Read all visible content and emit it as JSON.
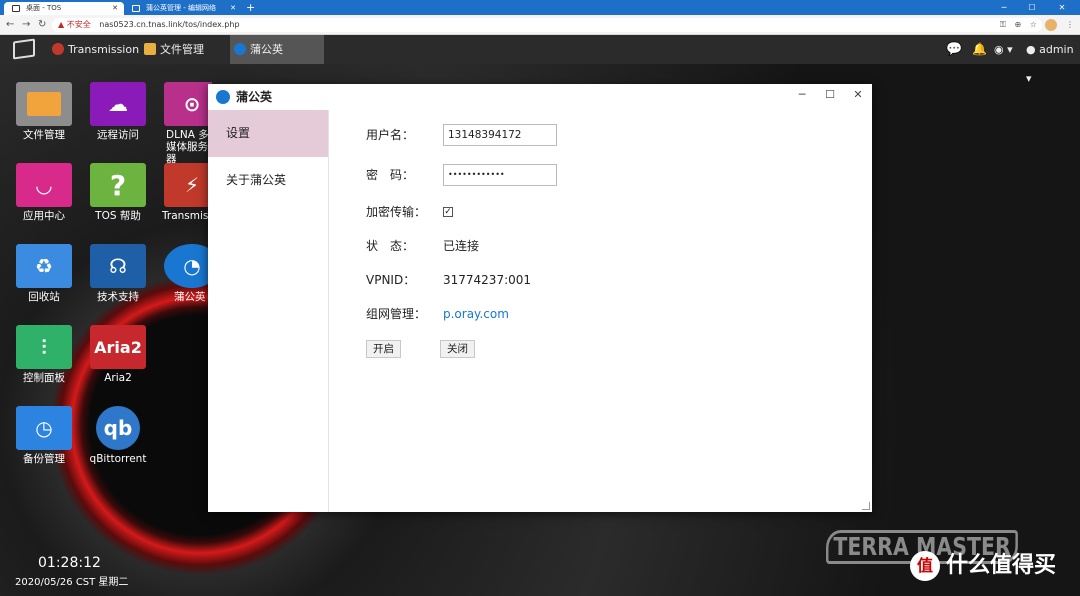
{
  "browser": {
    "tabs": [
      {
        "label": "桌面 - TOS",
        "active": true
      },
      {
        "label": "蒲公英管理 - 编辑网络",
        "active": false
      }
    ],
    "insecure_label": "不安全",
    "url": "nas0523.cn.tnas.link/tos/index.php"
  },
  "taskbar": {
    "items": [
      {
        "label": "Transmission"
      },
      {
        "label": "文件管理"
      },
      {
        "label": "蒲公英"
      }
    ],
    "user": "admin"
  },
  "desktop_icons": [
    {
      "label": "文件管理",
      "color": "#8d8d8d",
      "icon": "folder-icon"
    },
    {
      "label": "远程访问",
      "color": "#8b1bb8",
      "icon": "cloud-icon"
    },
    {
      "label": "DLNA 多媒体服务器",
      "color": "#b8308a",
      "icon": "dlna-icon"
    },
    {
      "label": "应用中心",
      "color": "#d82a8b",
      "icon": "shopping-bag-icon"
    },
    {
      "label": "TOS 帮助",
      "color": "#6db33f",
      "icon": "question-icon"
    },
    {
      "label": "Transmission",
      "color": "#c0392b",
      "icon": "transmission-icon"
    },
    {
      "label": "回收站",
      "color": "#3b8be0",
      "icon": "recycle-icon"
    },
    {
      "label": "技术支持",
      "color": "#1e5fa8",
      "icon": "headset-icon"
    },
    {
      "label": "蒲公英",
      "color": "#1977d1",
      "icon": "pgy-icon"
    },
    {
      "label": "控制面板",
      "color": "#2fb16a",
      "icon": "sliders-icon"
    },
    {
      "label": "Aria2",
      "color": "#c6282e",
      "icon": "aria2-icon"
    },
    {
      "label": "备份管理",
      "color": "#2d84e0",
      "icon": "clock-icon"
    },
    {
      "label": "qBittorrent",
      "color": "#2e77c9",
      "icon": "qb-icon"
    }
  ],
  "clock": {
    "time": "01:28:12",
    "date": "2020/05/26 CST 星期二"
  },
  "brand": "TERRA MASTER",
  "watermark": {
    "glyph": "值",
    "text": "什么值得买"
  },
  "window": {
    "title": "蒲公英",
    "sidebar": [
      {
        "label": "设置",
        "active": true
      },
      {
        "label": "关于蒲公英",
        "active": false
      }
    ],
    "fields": {
      "username_label": "用户名：",
      "username_value": "13148394172",
      "password_label": "密　码：",
      "password_value": "••••••••••••",
      "encrypt_label": "加密传输：",
      "encrypt_checked": true,
      "status_label": "状　态：",
      "status_value": "已连接",
      "vpnid_label": "VPNID：",
      "vpnid_value": "31774237:001",
      "network_label": "组网管理：",
      "network_link": "p.oray.com"
    },
    "buttons": {
      "start": "开启",
      "stop": "关闭"
    }
  }
}
